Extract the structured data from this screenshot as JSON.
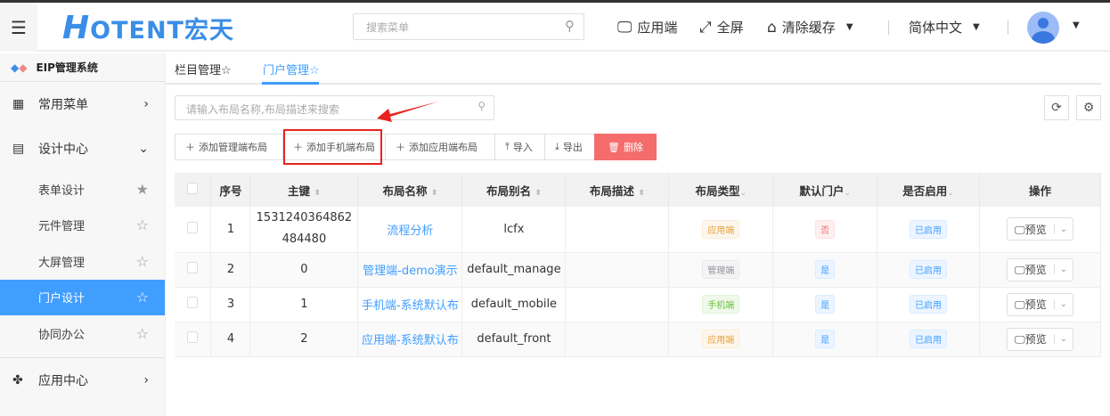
{
  "header": {
    "logo_text": "HOTENT宏天",
    "menu_search_placeholder": "搜索菜单",
    "app_end": "应用端",
    "fullscreen": "全屏",
    "clear_cache": "清除缓存",
    "language": "简体中文"
  },
  "sidebar": {
    "system_title": "EIP管理系统",
    "groups": [
      {
        "label": "常用菜单",
        "icon": "grid-icon"
      },
      {
        "label": "设计中心",
        "icon": "design-doc-icon",
        "children": [
          "表单设计",
          "元件管理",
          "大屏管理",
          "门户设计",
          "协同办公"
        ],
        "active": "门户设计"
      },
      {
        "label": "应用中心",
        "icon": "apps-icon"
      }
    ]
  },
  "tabs": [
    {
      "label": "栏目管理☆"
    },
    {
      "label": "门户管理☆",
      "active": true
    }
  ],
  "search": {
    "placeholder": "请输入布局名称,布局描述来搜索"
  },
  "toolbar": {
    "add_manage": "添加管理端布局",
    "add_mobile": "添加手机端布局",
    "add_front": "添加应用端布局",
    "import": "导入",
    "export": "导出",
    "delete": "删除"
  },
  "table": {
    "headers": [
      "序号",
      "主键",
      "布局名称",
      "布局别名",
      "布局描述",
      "布局类型",
      "默认门户",
      "是否启用",
      "操作"
    ],
    "rows": [
      {
        "no": "1",
        "key": "1531240364862484480",
        "name": "流程分析",
        "alias": "lcfx",
        "desc": "",
        "type": "应用端",
        "default": "否",
        "enabled": "已启用",
        "action": "预览"
      },
      {
        "no": "2",
        "key": "0",
        "name": "管理端-demo演示",
        "alias": "default_manage",
        "desc": "",
        "type": "管理端",
        "default": "是",
        "enabled": "已启用",
        "action": "预览"
      },
      {
        "no": "3",
        "key": "1",
        "name": "手机端-系统默认布",
        "alias": "default_mobile",
        "desc": "",
        "type": "手机端",
        "default": "是",
        "enabled": "已启用",
        "action": "预览"
      },
      {
        "no": "4",
        "key": "2",
        "name": "应用端-系统默认布",
        "alias": "default_front",
        "desc": "",
        "type": "应用端",
        "default": "是",
        "enabled": "已启用",
        "action": "预览"
      }
    ]
  },
  "colors": {
    "primary": "#409eff",
    "danger": "#f56c6c",
    "annotation": "#e8231e"
  }
}
